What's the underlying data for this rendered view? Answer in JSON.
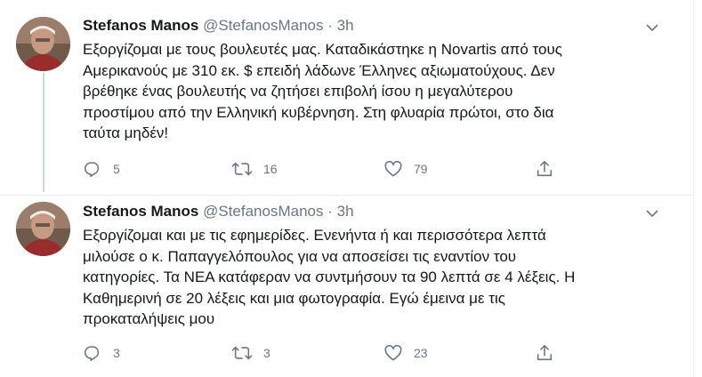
{
  "colors": {
    "text": "#14171a",
    "muted": "#657786",
    "border": "#e6ecf0",
    "thread": "#ccd6dd"
  },
  "tweets": [
    {
      "name": "Stefanos Manos",
      "handle": "@StefanosManos",
      "dot": "·",
      "time": "3h",
      "lines": [
        "Εξοργίζομαι με τους βουλευτές μας. Καταδικάστηκε η Novartis από τους",
        "Αμερικανούς με 310 εκ. $ επειδή λάδωνε Έλληνες αξιωματούχους. Δεν",
        "βρέθηκε ένας βουλευτής να ζητήσει επιβολή ίσου η μεγαλύτερου",
        "προστίμου από την Ελληνική κυβέρνηση. Στη φλυαρία πρώτοι, στο δια",
        "ταύτα μηδέν!"
      ],
      "replies": "5",
      "retweets": "16",
      "likes": "79",
      "icons": [
        "reply-icon",
        "retweet-icon",
        "like-icon",
        "share-icon",
        "chevron-down-icon"
      ]
    },
    {
      "name": "Stefanos Manos",
      "handle": "@StefanosManos",
      "dot": "·",
      "time": "3h",
      "lines": [
        "Εξοργίζομαι και με τις εφημερίδες. Ενενήντα ή και περισσότερα λεπτά",
        "μιλούσε ο κ. Παπαγγελόπουλος για να αποσείσει τις εναντίον του",
        "κατηγορίες. Τα ΝΕΑ κατάφεραν να συντμήσουν τα 90 λεπτά σε 4 λέξεις. Η",
        "Καθημερινή σε 20 λέξεις και μια φωτογραφία. Εγώ έμεινα με τις",
        "προκαταλήψεις μου"
      ],
      "replies": "3",
      "retweets": "3",
      "likes": "23",
      "icons": [
        "reply-icon",
        "retweet-icon",
        "like-icon",
        "share-icon",
        "chevron-down-icon"
      ]
    }
  ]
}
